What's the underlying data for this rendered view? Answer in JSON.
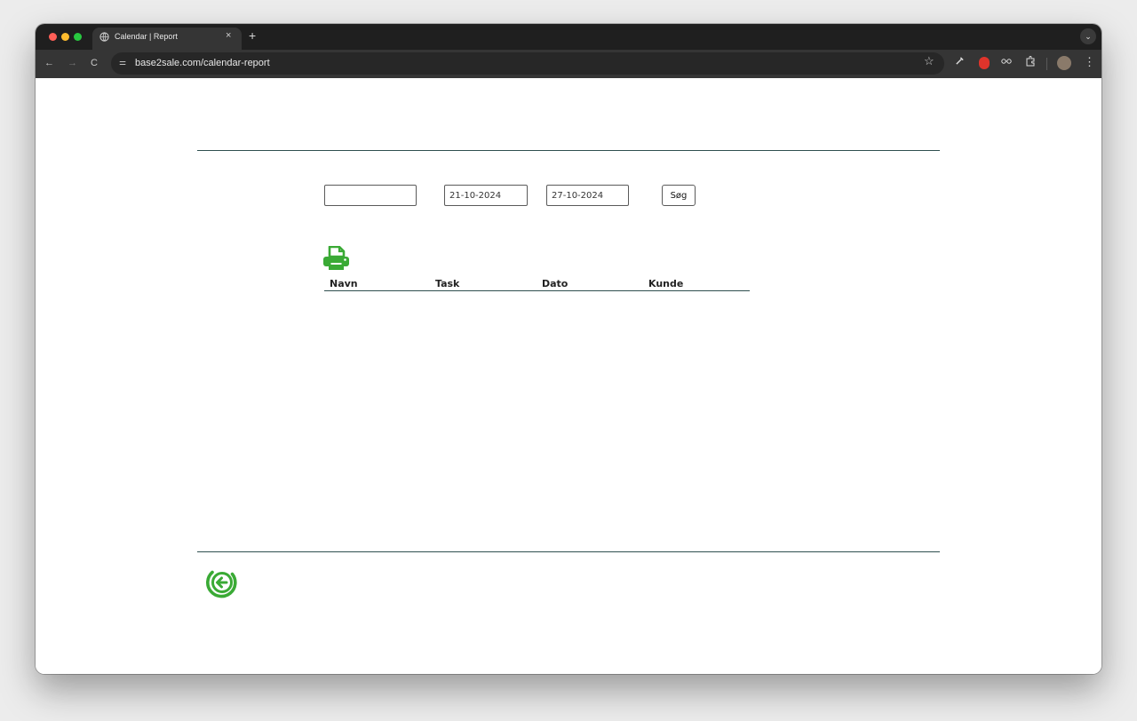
{
  "browser": {
    "tab_title": "Calendar | Report",
    "tab_close": "×",
    "new_tab": "+",
    "tab_menu": "⌄",
    "url": "base2sale.com/calendar-report",
    "back": "←",
    "forward": "→",
    "reload": "C",
    "site_info": "⚌",
    "bookmark": "☆",
    "menu": "⋮",
    "extensions": [
      "color-picker-icon",
      "shield-extension-icon",
      "glasses-extension-icon",
      "puzzle-icon"
    ]
  },
  "filters": {
    "name_value": "",
    "from_date": "21-10-2024",
    "to_date": "27-10-2024",
    "search_label": "Søg"
  },
  "table": {
    "headers": [
      "Navn",
      "Task",
      "Dato",
      "Kunde"
    ],
    "rows": []
  },
  "colors": {
    "accent_green": "#3aaa35",
    "rule": "#2f4f4f"
  }
}
